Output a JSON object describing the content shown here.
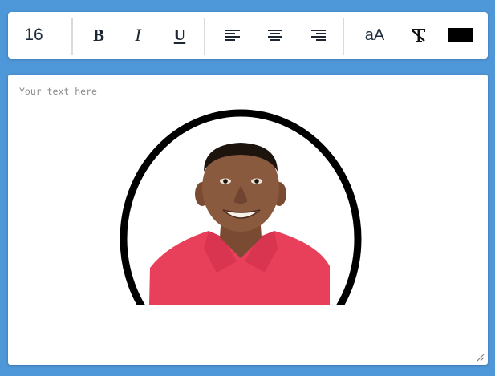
{
  "toolbar": {
    "font_size": "16",
    "bold_label": "B",
    "italic_label": "I",
    "underline_label": "U",
    "case_label": "aA",
    "color_value": "#000000",
    "icons": [
      "align-left-icon",
      "align-center-icon",
      "align-right-icon",
      "clear-format-icon"
    ]
  },
  "editor": {
    "placeholder": "Your text here",
    "image": "portrait-of-smiling-man-in-red-shirt-inside-black-oval-frame"
  },
  "colors": {
    "background": "#4e97d8",
    "panel": "#ffffff",
    "shirt": "#e8405a",
    "frame": "#000000"
  }
}
